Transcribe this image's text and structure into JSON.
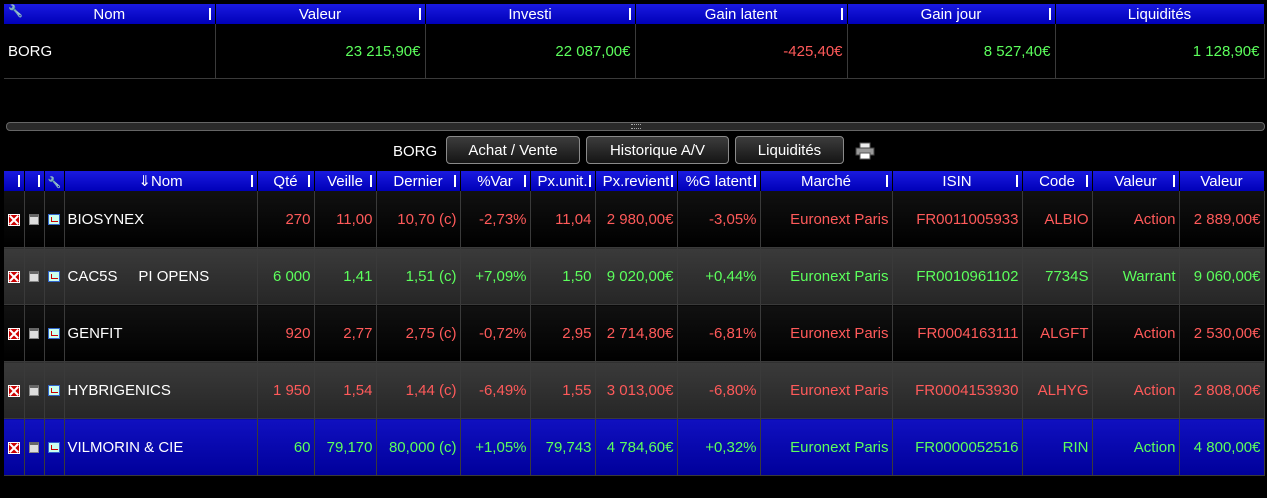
{
  "summary": {
    "headers": [
      "Nom",
      "Valeur",
      "Investi",
      "Gain latent",
      "Gain jour",
      "Liquidités"
    ],
    "row": [
      "BORG",
      "23 215,90€",
      "22 087,00€",
      "-425,40€",
      "8 527,40€",
      "1 128,90€"
    ]
  },
  "toolbar": {
    "portfolio_label": "BORG",
    "buy_sell": "Achat / Vente",
    "history": "Historique A/V",
    "cash": "Liquidités"
  },
  "positions": {
    "headers": [
      "⇓Nom",
      "Qté",
      "Veille",
      "Dernier",
      "%Var",
      "Px.unit.",
      "Px.revient",
      "%G latent",
      "Marché",
      "ISIN",
      "Code",
      "Valeur",
      "Valeur"
    ],
    "rows": [
      [
        "BIOSYNEX",
        "270",
        "11,00",
        "10,70 (c)",
        "-2,73%",
        "11,04",
        "2 980,00€",
        "-3,05%",
        "Euronext Paris",
        "FR0011005933",
        "ALBIO",
        "Action",
        "2 889,00€"
      ],
      [
        "CAC5S     PI OPENS",
        "6 000",
        "1,41",
        "1,51 (c)",
        "+7,09%",
        "1,50",
        "9 020,00€",
        "+0,44%",
        "Euronext Paris",
        "FR0010961102",
        "7734S",
        "Warrant",
        "9 060,00€"
      ],
      [
        "GENFIT",
        "920",
        "2,77",
        "2,75 (c)",
        "-0,72%",
        "2,95",
        "2 714,80€",
        "-6,81%",
        "Euronext Paris",
        "FR0004163111",
        "ALGFT",
        "Action",
        "2 530,00€"
      ],
      [
        "HYBRIGENICS",
        "1 950",
        "1,54",
        "1,44 (c)",
        "-6,49%",
        "1,55",
        "3 013,00€",
        "-6,80%",
        "Euronext Paris",
        "FR0004153930",
        "ALHYG",
        "Action",
        "2 808,00€"
      ],
      [
        "VILMORIN & CIE",
        "60",
        "79,170",
        "80,000 (c)",
        "+1,05%",
        "79,743",
        "4 784,60€",
        "+0,32%",
        "Euronext Paris",
        "FR0000052516",
        "RIN",
        "Action",
        "4 800,00€"
      ]
    ]
  },
  "colors": {
    "header_blue": "#0000cc",
    "gain": "#5cff5c",
    "loss": "#ff5a5a",
    "selected_row": "#0000aa"
  }
}
